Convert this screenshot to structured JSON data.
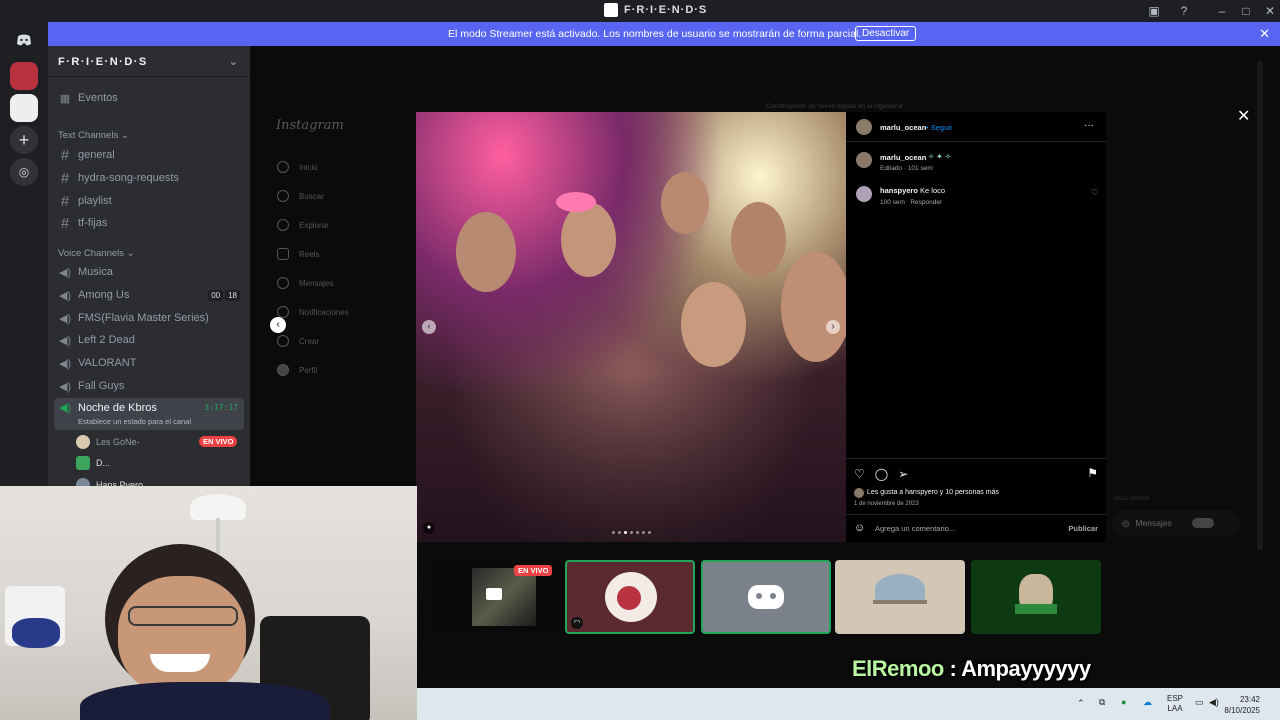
{
  "titlebar": {
    "title": "F·R·I·E·N·D·S"
  },
  "banner": {
    "message": "El modo Streamer está activado. Los nombres de usuario se mostrarán de forma parcial.",
    "button": "Desactivar"
  },
  "server": {
    "name": "F·R·I·E·N·D·S"
  },
  "sidebar": {
    "events": "Eventos",
    "text_category": "Text Channels",
    "text_channels": [
      "general",
      "hydra-song-requests",
      "playlist",
      "tf-fijas"
    ],
    "voice_category": "Voice Channels",
    "voice_channels": [
      "Musica",
      "Among Us",
      "FMS(Flavia Master Series)",
      "Left 2 Dead",
      "VALORANT",
      "Fall Guys"
    ],
    "among_us_counts": [
      "00",
      "18"
    ],
    "active_voice": {
      "name": "Noche de Kbros",
      "timer": "3:17:17",
      "status": "Establece un estado para el canal"
    },
    "members": [
      {
        "name": "Les GoNe-",
        "live": "EN VIVO"
      },
      {
        "name": "D..."
      },
      {
        "name": "Hans Pyero"
      }
    ]
  },
  "instagram": {
    "logo": "Instagram",
    "nav": [
      "Inicio",
      "Buscar",
      "Explorar",
      "Reels",
      "Mensajes",
      "Notificaciones",
      "Crear",
      "Perfil"
    ],
    "faded_top": "Construyendo un nuevo legado en la ingeniería",
    "post": {
      "author": "marlu_ocean",
      "follow": "Seguir",
      "caption_author": "marlu_ocean",
      "caption_meta": "Editado · 101 sem",
      "comment_author": "hanspyero",
      "comment_text": "Ke loco",
      "comment_meta": "100 sem",
      "reply": "Responder",
      "likes": "Les gusta a hanspyero y 10 personas más",
      "date": "1 de noviembre de 2023",
      "add_comment_placeholder": "Agrega un comentario...",
      "publish": "Publicar"
    },
    "messages_pill": "Mensajes",
    "meta_verified": "Meta Verified"
  },
  "stream_tiles": {
    "live_label": "EN VIVO"
  },
  "chat_overlay": {
    "user": "ElRemoo",
    "separator": " : ",
    "message": "Ampayyyyyy"
  },
  "taskbar": {
    "lang_top": "ESP",
    "lang_bottom": "LAA",
    "time": "23:42",
    "date": "8/10/2025"
  },
  "colors": {
    "discord_bg": "#2b2d31",
    "rail_bg": "#1e1f22",
    "banner": "#5865f2",
    "live": "#ed4245",
    "chat_user": "#b9f6a0"
  }
}
